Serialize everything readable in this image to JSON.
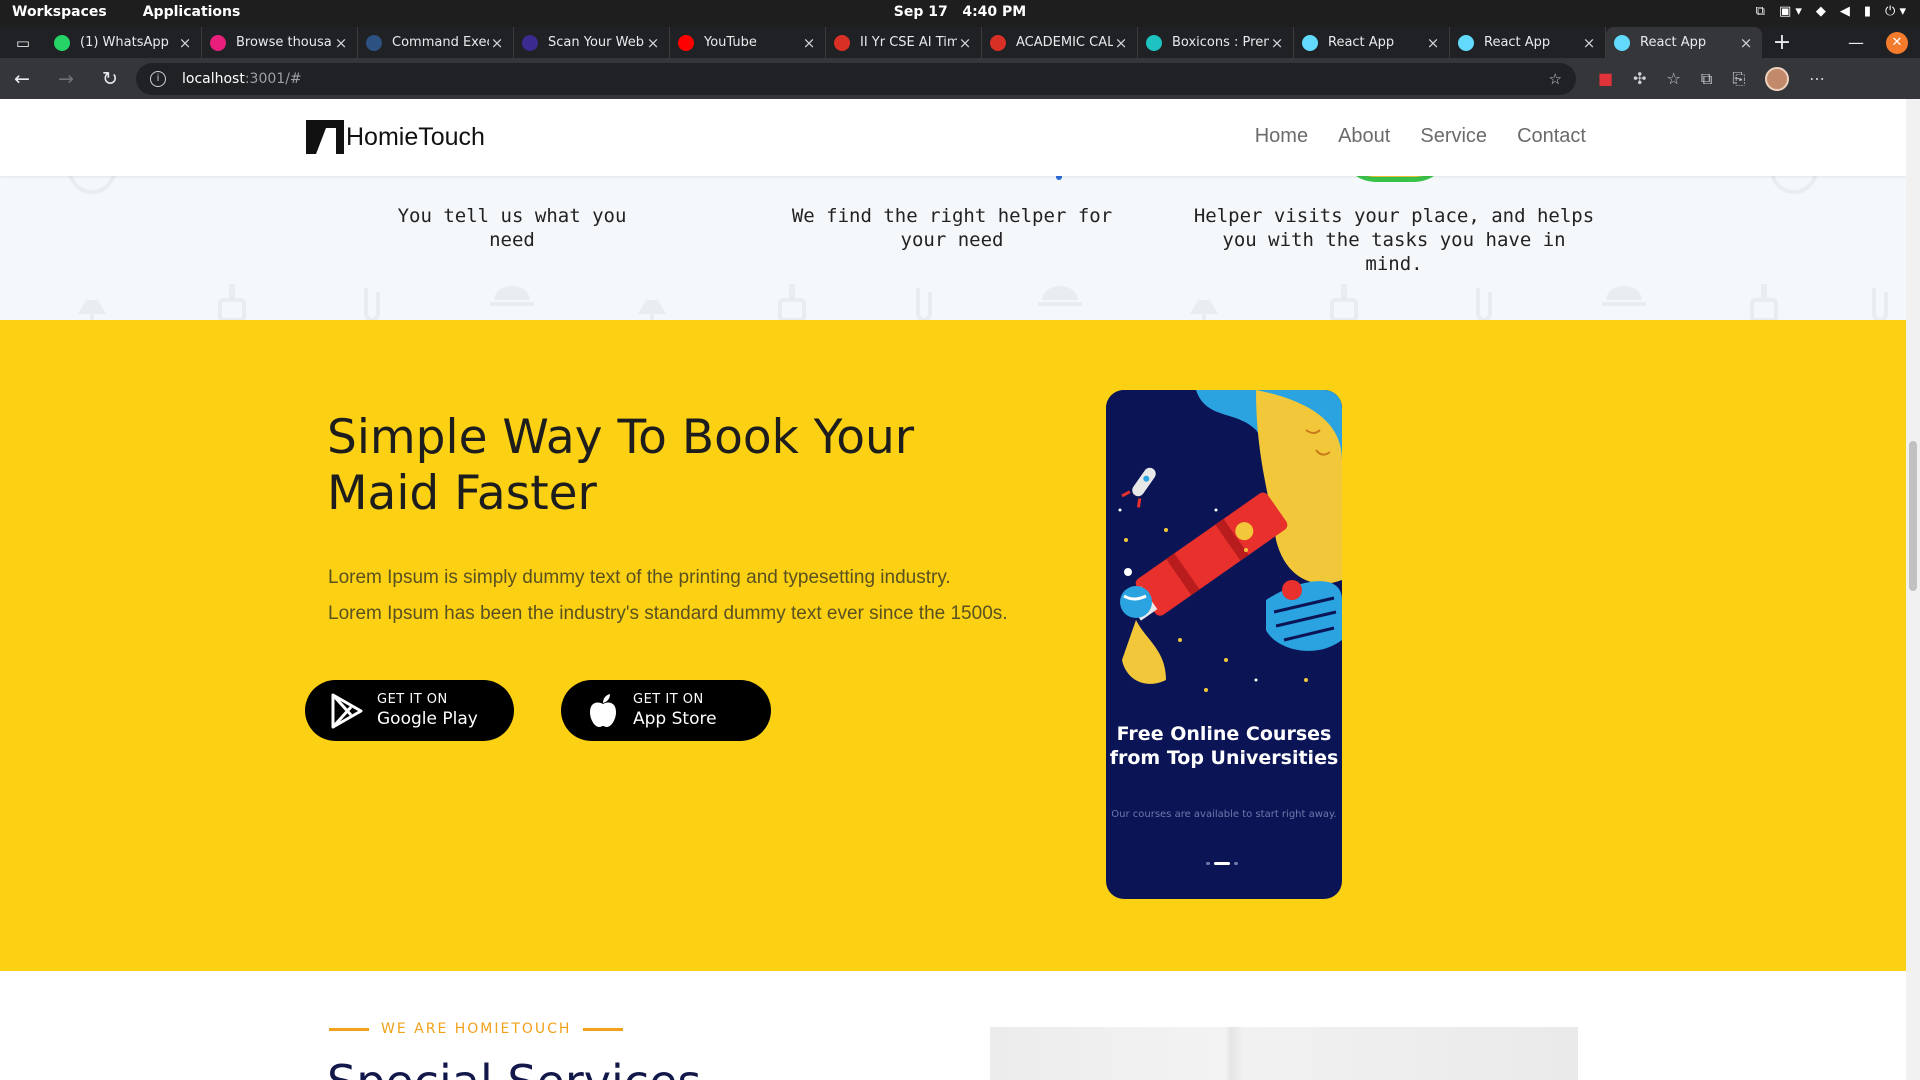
{
  "os": {
    "workspaces": "Workspaces",
    "applications": "Applications",
    "date": "Sep 17",
    "time": "4:40 PM"
  },
  "tabs": [
    {
      "title": "(1) WhatsApp",
      "icon": "whatsapp-icon",
      "color": "#25d366"
    },
    {
      "title": "Browse thousa",
      "icon": "dribbble-icon",
      "color": "#ea1f7b"
    },
    {
      "title": "Command Exec",
      "icon": "hackerrank-icon",
      "color": "#2c5282"
    },
    {
      "title": "Scan Your Web",
      "icon": "scanner-icon",
      "color": "#3b2a8f"
    },
    {
      "title": "YouTube",
      "icon": "youtube-icon",
      "color": "#ff0000"
    },
    {
      "title": "II Yr CSE AI Tim",
      "icon": "pdf-icon",
      "color": "#d93025"
    },
    {
      "title": "ACADEMIC CALE",
      "icon": "pdf-icon",
      "color": "#d93025"
    },
    {
      "title": "Boxicons : Prem",
      "icon": "boxicons-icon",
      "color": "#1ec2c0"
    },
    {
      "title": "React App",
      "icon": "react-icon",
      "color": "#61dafb"
    },
    {
      "title": "React App",
      "icon": "react-icon",
      "color": "#61dafb"
    },
    {
      "title": "React App",
      "icon": "react-icon",
      "color": "#61dafb",
      "active": true
    }
  ],
  "address": {
    "host": "localhost",
    "path": ":3001/#"
  },
  "site": {
    "brand": "HomieTouch",
    "nav": [
      "Home",
      "About",
      "Service",
      "Contact"
    ]
  },
  "steps": [
    "You tell us what you need",
    "We find the right helper for your need",
    "Helper visits your place, and helps you with the tasks you have in mind."
  ],
  "promo": {
    "heading": "Simple Way To Book Your Maid Faster",
    "body": "Lorem Ipsum is simply dummy text of the printing and typesetting industry. Lorem Ipsum has been the industry's standard dummy text ever since the 1500s.",
    "google": {
      "small": "GET IT ON",
      "big": "Google Play"
    },
    "apple": {
      "small": "GET IT ON",
      "big": "App Store"
    },
    "phone_title": "Free Online Courses from Top Universities",
    "phone_sub": "Our courses are available to start right away."
  },
  "services": {
    "kicker": "WE ARE HOMIETOUCH",
    "heading": "Special Services"
  },
  "colors": {
    "promo_bg": "#fcd013",
    "accent": "#f0a21a",
    "phone_bg": "#0b1556"
  }
}
